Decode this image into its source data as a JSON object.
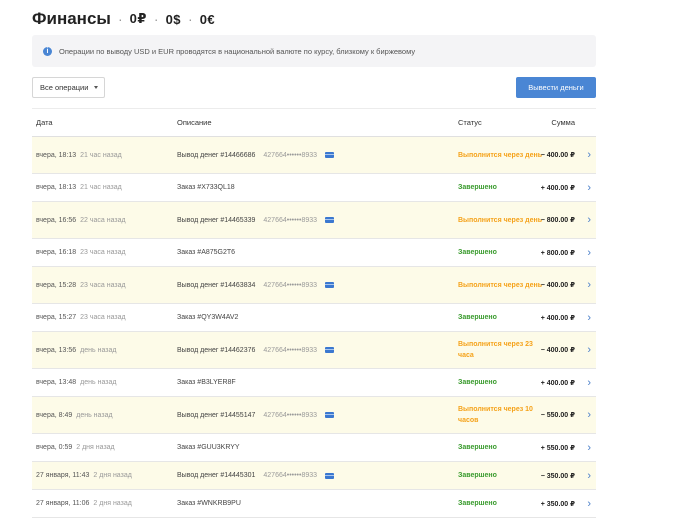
{
  "header": {
    "title": "Финансы",
    "separator": "·",
    "balances": [
      "0₽",
      "0$",
      "0€"
    ]
  },
  "notice": {
    "icon": "info-icon",
    "text": "Операции по выводу USD и EUR проводятся в национальной валюте по курсу, близкому к биржевому"
  },
  "filter": {
    "selected": "Все операции"
  },
  "withdraw_button": {
    "label": "Вывести деньги"
  },
  "table": {
    "columns": {
      "date": "Дата",
      "description": "Описание",
      "status": "Статус",
      "amount": "Сумма"
    },
    "rows": [
      {
        "date": "вчера, 18:13",
        "ago": "21 час назад",
        "desc": "Вывод денег #14466686",
        "card": "427664••••••8933",
        "status": "Выполнится через день",
        "amount": "− 400.00 ₽"
      },
      {
        "date": "вчера, 18:13",
        "ago": "21 час назад",
        "desc": "Заказ #X733QL18",
        "card": "",
        "status": "Завершено",
        "amount": "+ 400.00 ₽"
      },
      {
        "date": "вчера, 16:56",
        "ago": "22 часа назад",
        "desc": "Вывод денег #14465339",
        "card": "427664••••••8933",
        "status": "Выполнится через день",
        "amount": "− 800.00 ₽"
      },
      {
        "date": "вчера, 16:18",
        "ago": "23 часа назад",
        "desc": "Заказ #A875G2T6",
        "card": "",
        "status": "Завершено",
        "amount": "+ 800.00 ₽"
      },
      {
        "date": "вчера, 15:28",
        "ago": "23 часа назад",
        "desc": "Вывод денег #14463834",
        "card": "427664••••••8933",
        "status": "Выполнится через день",
        "amount": "− 400.00 ₽"
      },
      {
        "date": "вчера, 15:27",
        "ago": "23 часа назад",
        "desc": "Заказ #QY3W4AV2",
        "card": "",
        "status": "Завершено",
        "amount": "+ 400.00 ₽"
      },
      {
        "date": "вчера, 13:56",
        "ago": "день назад",
        "desc": "Вывод денег #14462376",
        "card": "427664••••••8933",
        "status": "Выполнится через 23 часа",
        "amount": "− 400.00 ₽"
      },
      {
        "date": "вчера, 13:48",
        "ago": "день назад",
        "desc": "Заказ #B3LYER8F",
        "card": "",
        "status": "Завершено",
        "amount": "+ 400.00 ₽"
      },
      {
        "date": "вчера, 8:49",
        "ago": "день назад",
        "desc": "Вывод денег #14455147",
        "card": "427664••••••8933",
        "status": "Выполнится через 10 часов",
        "amount": "− 550.00 ₽"
      },
      {
        "date": "вчера, 0:59",
        "ago": "2 дня назад",
        "desc": "Заказ #GUU3KRYY",
        "card": "",
        "status": "Завершено",
        "amount": "+ 550.00 ₽"
      },
      {
        "date": "27 января, 11:43",
        "ago": "2 дня назад",
        "desc": "Вывод денег #14445301",
        "card": "427664••••••8933",
        "status": "Завершено",
        "amount": "− 350.00 ₽"
      },
      {
        "date": "27 января, 11:06",
        "ago": "2 дня назад",
        "desc": "Заказ #WNKRB9PU",
        "card": "",
        "status": "Завершено",
        "amount": "+ 350.00 ₽"
      }
    ]
  },
  "colors": {
    "accent": "#4a86d4",
    "pending_row_bg": "#fdfbe8",
    "status_done": "#3a9b2e",
    "status_pending": "#f5a21a"
  }
}
